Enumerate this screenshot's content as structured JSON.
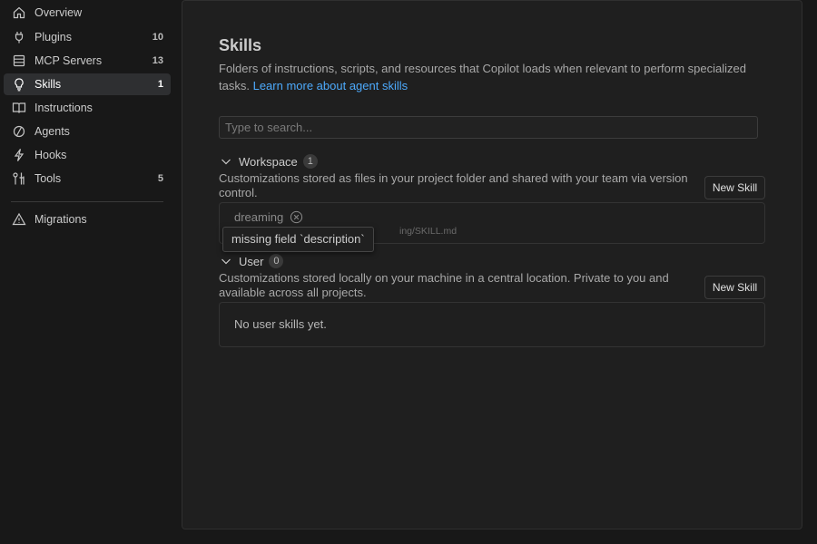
{
  "sidebar": {
    "items": [
      {
        "label": "Overview",
        "count": "",
        "icon": "home-icon"
      },
      {
        "label": "Plugins",
        "count": "10",
        "icon": "plug-icon"
      },
      {
        "label": "MCP Servers",
        "count": "13",
        "icon": "server-icon"
      },
      {
        "label": "Skills",
        "count": "1",
        "icon": "lightbulb-icon",
        "active": true
      },
      {
        "label": "Instructions",
        "count": "",
        "icon": "book-icon"
      },
      {
        "label": "Agents",
        "count": "",
        "icon": "agent-icon"
      },
      {
        "label": "Hooks",
        "count": "",
        "icon": "lightning-icon"
      },
      {
        "label": "Tools",
        "count": "5",
        "icon": "tools-icon"
      }
    ],
    "footer_items": [
      {
        "label": "Migrations",
        "icon": "warning-icon"
      }
    ]
  },
  "main": {
    "title": "Skills",
    "description": "Folders of instructions, scripts, and resources that Copilot loads when relevant to perform specialized tasks.",
    "learn_more_link": "Learn more about agent skills",
    "search_placeholder": "Type to search...",
    "sections": [
      {
        "title": "Workspace",
        "count": "1",
        "description": "Customizations stored as files in your project folder and shared with your team via version control.",
        "button": "New Skill",
        "items": [
          {
            "name": "dreaming",
            "path_visible": "ing/SKILL.md",
            "error": true
          }
        ]
      },
      {
        "title": "User",
        "count": "0",
        "description": "Customizations stored locally on your machine in a central location. Private to you and available across all projects.",
        "button": "New Skill",
        "empty_text": "No user skills yet."
      }
    ],
    "tooltip": "missing field `description`"
  },
  "colors": {
    "accent_link": "#4daafc",
    "active_bg": "#2e2f31",
    "panel_bg": "#1f1f1f",
    "sidebar_bg": "#181818"
  }
}
